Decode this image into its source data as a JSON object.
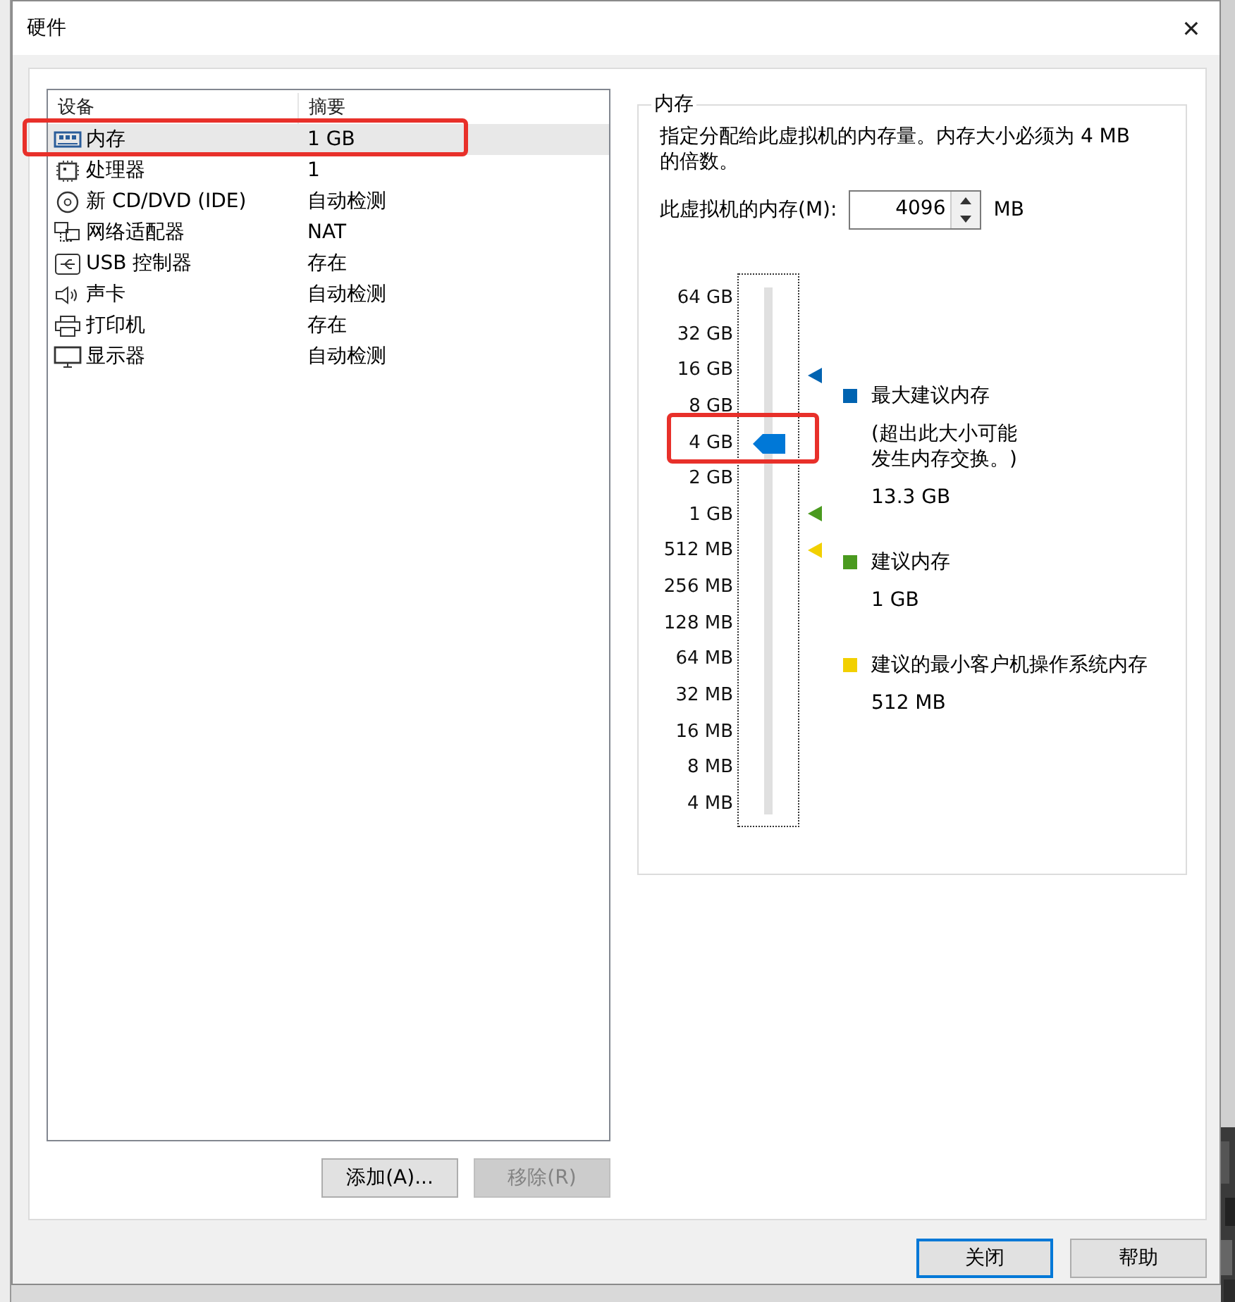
{
  "window": {
    "title": "硬件",
    "close": "✕"
  },
  "devices": {
    "columns": [
      "设备",
      "摘要"
    ],
    "rows": [
      {
        "kind": "memory",
        "name": "内存",
        "summary": "1 GB",
        "selected": true,
        "highlighted": true
      },
      {
        "kind": "cpu",
        "name": "处理器",
        "summary": "1",
        "selected": false,
        "highlighted": false
      },
      {
        "kind": "disc",
        "name": "新 CD/DVD (IDE)",
        "summary": "自动检测",
        "selected": false,
        "highlighted": false
      },
      {
        "kind": "network",
        "name": "网络适配器",
        "summary": "NAT",
        "selected": false,
        "highlighted": false
      },
      {
        "kind": "usb",
        "name": "USB 控制器",
        "summary": "存在",
        "selected": false,
        "highlighted": false
      },
      {
        "kind": "sound",
        "name": "声卡",
        "summary": "自动检测",
        "selected": false,
        "highlighted": false
      },
      {
        "kind": "printer",
        "name": "打印机",
        "summary": "存在",
        "selected": false,
        "highlighted": false
      },
      {
        "kind": "display",
        "name": "显示器",
        "summary": "自动检测",
        "selected": false,
        "highlighted": false
      }
    ],
    "buttons": [
      {
        "label": "添加(A)...",
        "disabled": false
      },
      {
        "label": "移除(R)",
        "disabled": true
      }
    ]
  },
  "memory": {
    "title": "内存",
    "description": "指定分配给此虚拟机的内存量。内存大小必须为 4 MB\n的倍数。",
    "field_label": "此虚拟机的内存(M):",
    "value": "4096",
    "unit": "MB",
    "slider": {
      "labels": [
        "64 GB",
        "32 GB",
        "16 GB",
        "8 GB",
        "4 GB",
        "2 GB",
        "1 GB",
        "512 MB",
        "256 MB",
        "128 MB",
        "64 MB",
        "32 MB",
        "16 MB",
        "8 MB",
        "4 MB"
      ],
      "level": 0.714,
      "highlighted": true
    },
    "legend": [
      {
        "title": "最大建议内存",
        "note": [
          "(超出此大小可能",
          "发生内存交换。)"
        ],
        "value": "13.3 GB",
        "color": "#0063b1"
      },
      {
        "title": "建议内存",
        "value": "1 GB",
        "color": "#4a9a1f"
      },
      {
        "title": "建议的最小客户机操作系统内存",
        "value": "512 MB",
        "color": "#f2d000"
      }
    ]
  },
  "footer_buttons": [
    {
      "label": "关闭",
      "default": true
    },
    {
      "label": "帮助",
      "default": false
    }
  ]
}
